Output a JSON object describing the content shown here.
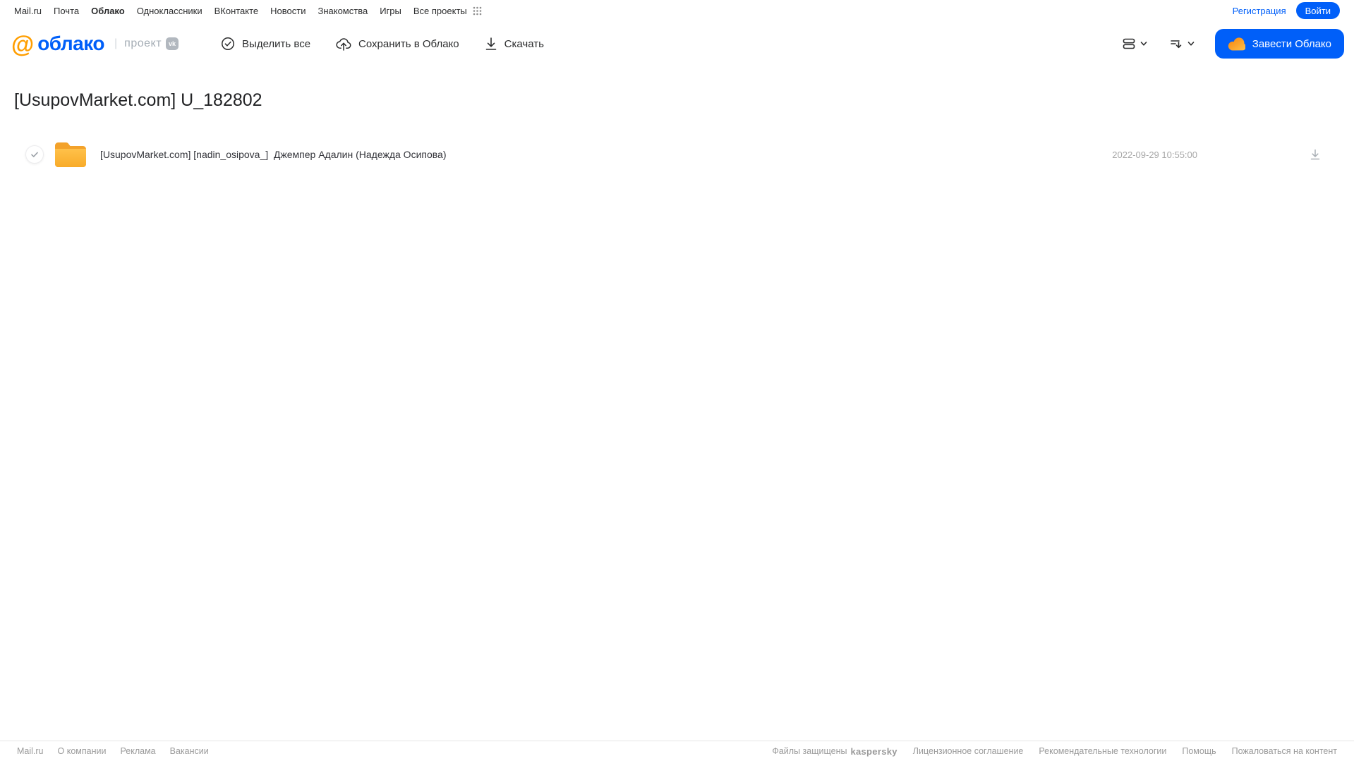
{
  "topbar": {
    "links": [
      "Mail.ru",
      "Почта",
      "Облако",
      "Одноклассники",
      "ВКонтакте",
      "Новости",
      "Знакомства",
      "Игры",
      "Все проекты"
    ],
    "active_link": "Облако",
    "registration": "Регистрация",
    "login": "Войти"
  },
  "header": {
    "logo_at": "@",
    "logo_text": "облако",
    "logo_divider": "|",
    "project_label": "проект",
    "vk_badge": "vk",
    "select_all": "Выделить все",
    "save_to_cloud": "Сохранить в Облако",
    "download": "Скачать",
    "get_cloud": "Завести Облако"
  },
  "main": {
    "title": "[UsupovMarket.com] U_182802",
    "files": [
      {
        "type": "folder",
        "name": "[UsupovMarket.com] [nadin_osipova_]  Джемпер Адалин (Надежда Осипова)",
        "date": "2022-09-29 10:55:00"
      }
    ]
  },
  "footer": {
    "left_links": [
      "Mail.ru",
      "О компании",
      "Реклама",
      "Вакансии"
    ],
    "protected_label": "Файлы защищены",
    "kaspersky_label": "kaspersky",
    "right_links": [
      "Лицензионное соглашение",
      "Рекомендательные технологии",
      "Помощь",
      "Пожаловаться на контент"
    ]
  },
  "colors": {
    "accent_blue": "#005ff9",
    "logo_orange": "#ff9e00",
    "folder_yellow": "#fbb03b",
    "kaspersky_teal": "#00847b"
  }
}
